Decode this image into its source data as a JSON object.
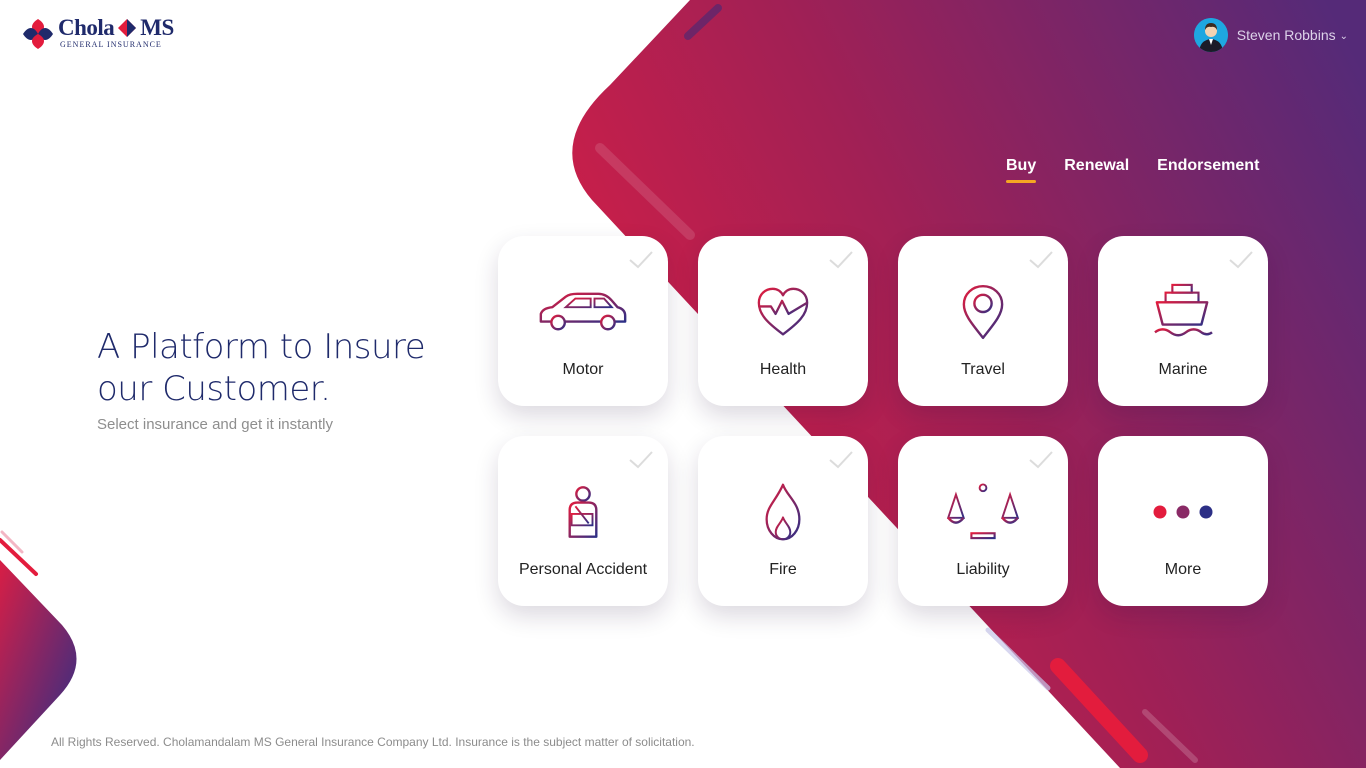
{
  "brand": {
    "name_left": "Chola",
    "name_right": "MS",
    "tagline": "GENERAL INSURANCE",
    "colors": {
      "navy": "#1f2a6b",
      "red": "#e31c3d",
      "accent": "#f5a623",
      "purple": "#552a78"
    }
  },
  "user": {
    "name": "Steven Robbins",
    "avatar_icon": "user-avatar-icon",
    "menu_icon": "chevron-down-icon"
  },
  "tabs": [
    {
      "label": "Buy",
      "active": true
    },
    {
      "label": "Renewal",
      "active": false
    },
    {
      "label": "Endorsement",
      "active": false
    }
  ],
  "hero": {
    "title_line1": "A Platform to Insure",
    "title_line2": "our Customer.",
    "subtitle": "Select insurance and get it instantly"
  },
  "products": [
    {
      "label": "Motor",
      "icon": "car-icon"
    },
    {
      "label": "Health",
      "icon": "heart-pulse-icon"
    },
    {
      "label": "Travel",
      "icon": "location-pin-icon"
    },
    {
      "label": "Marine",
      "icon": "ship-icon"
    },
    {
      "label": "Personal Accident",
      "icon": "injured-person-icon"
    },
    {
      "label": "Fire",
      "icon": "flame-icon"
    },
    {
      "label": "Liability",
      "icon": "scales-icon"
    },
    {
      "label": "More",
      "icon": "more-dots-icon"
    }
  ],
  "footer": {
    "text": "All Rights Reserved. Cholamandalam MS General Insurance Company Ltd. Insurance is the subject matter of solicitation."
  }
}
